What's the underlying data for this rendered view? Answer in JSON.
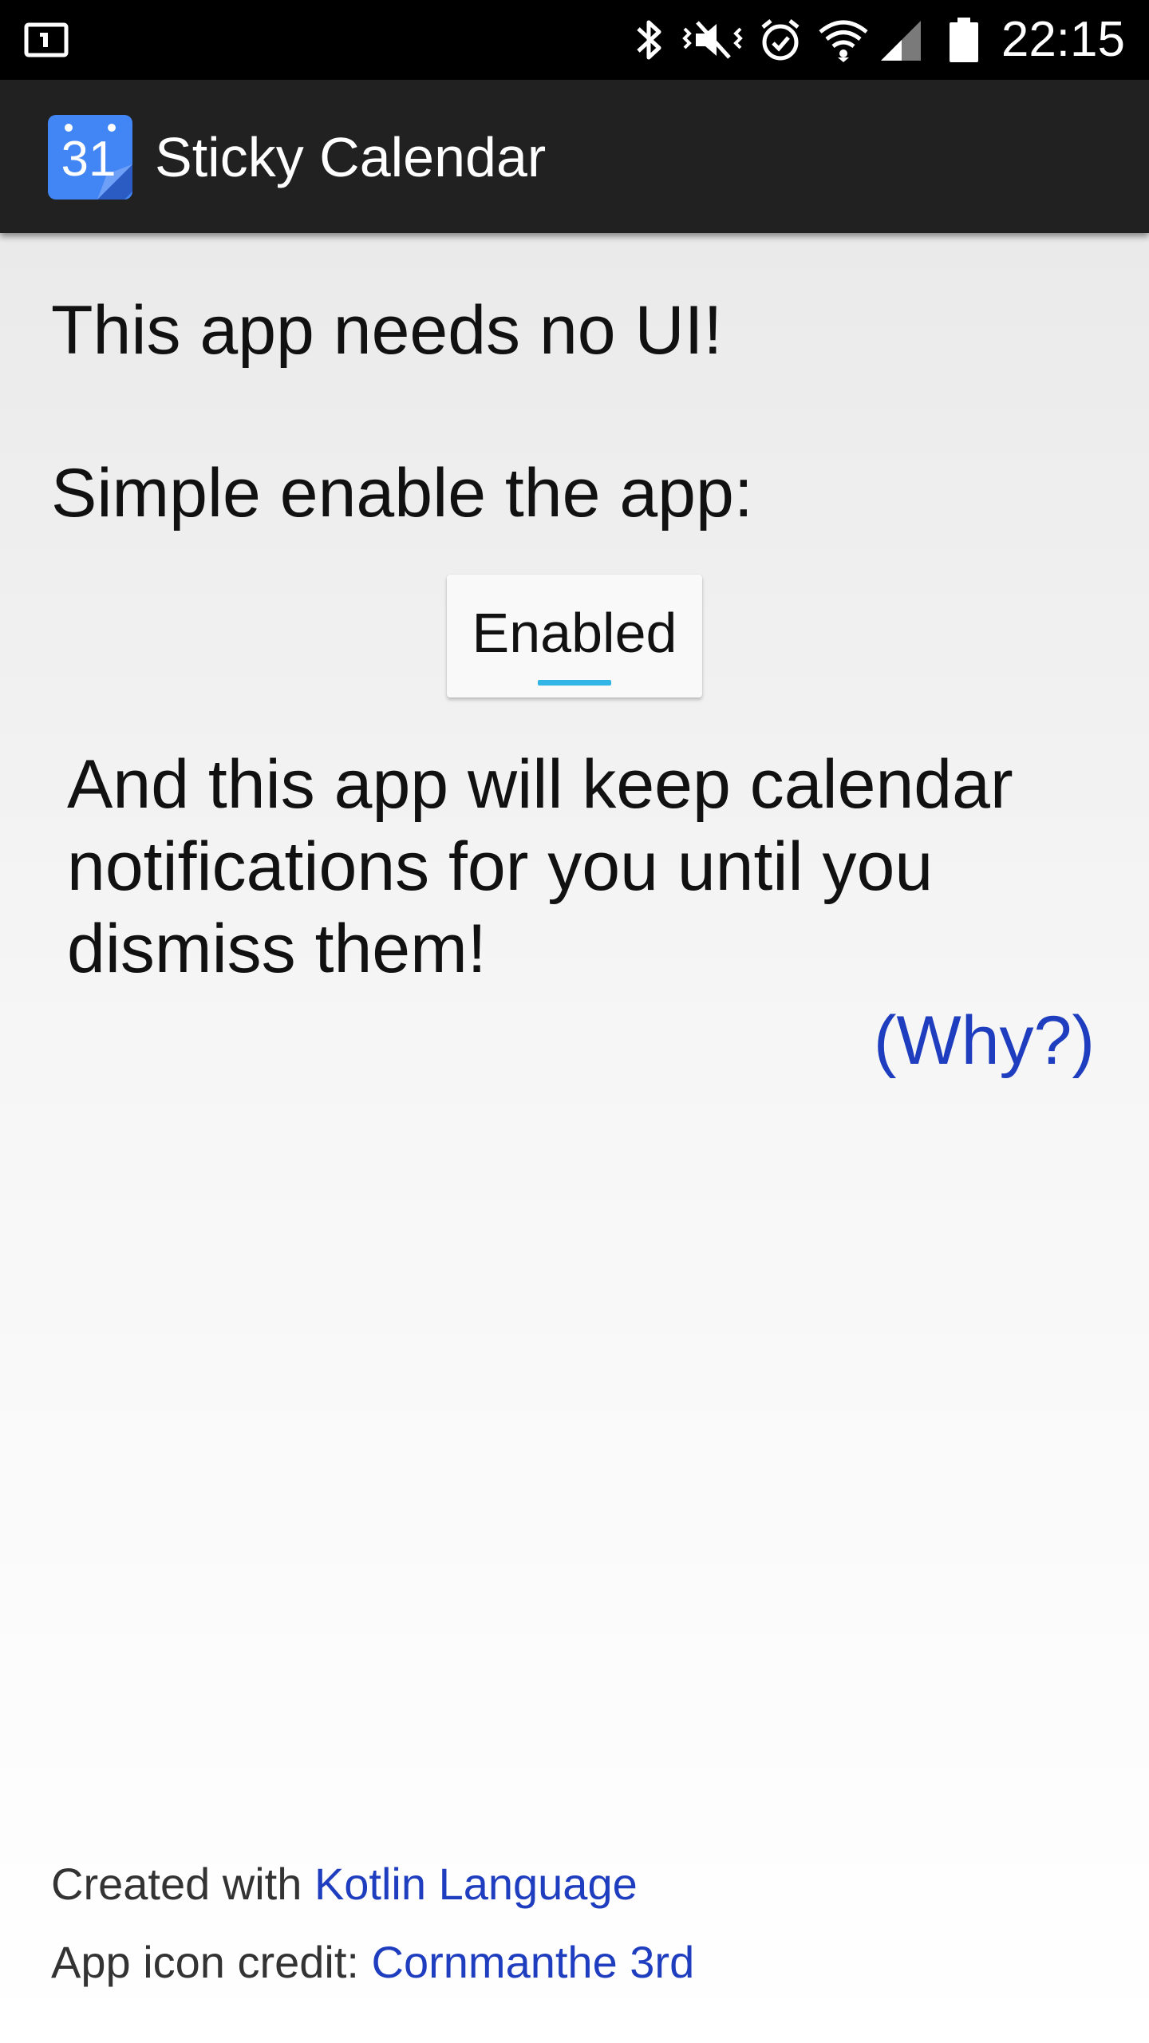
{
  "status_bar": {
    "time": "22:15",
    "icons": [
      "notification-screen-icon",
      "bluetooth-icon",
      "vibrate-icon",
      "alarm-icon",
      "wifi-icon",
      "signal-icon",
      "battery-icon"
    ]
  },
  "app_bar": {
    "icon_text": "31",
    "title": "Sticky Calendar",
    "icon_color": "#4285f4"
  },
  "main": {
    "line1": "This app needs no UI!",
    "line2": "Simple enable the app:",
    "toggle_label": "Enabled",
    "toggle_accent": "#33b5e5",
    "description_lines": [
      "And this app will keep calendar",
      "notifications for you until you",
      "dismiss them!"
    ],
    "why_link": "(Why?)"
  },
  "footer": {
    "created_prefix": "Created with ",
    "created_link": "Kotlin Language",
    "credit_prefix": "App icon credit: ",
    "credit_link": "Cornmanthe 3rd",
    "link_color": "#1e3dbf"
  }
}
